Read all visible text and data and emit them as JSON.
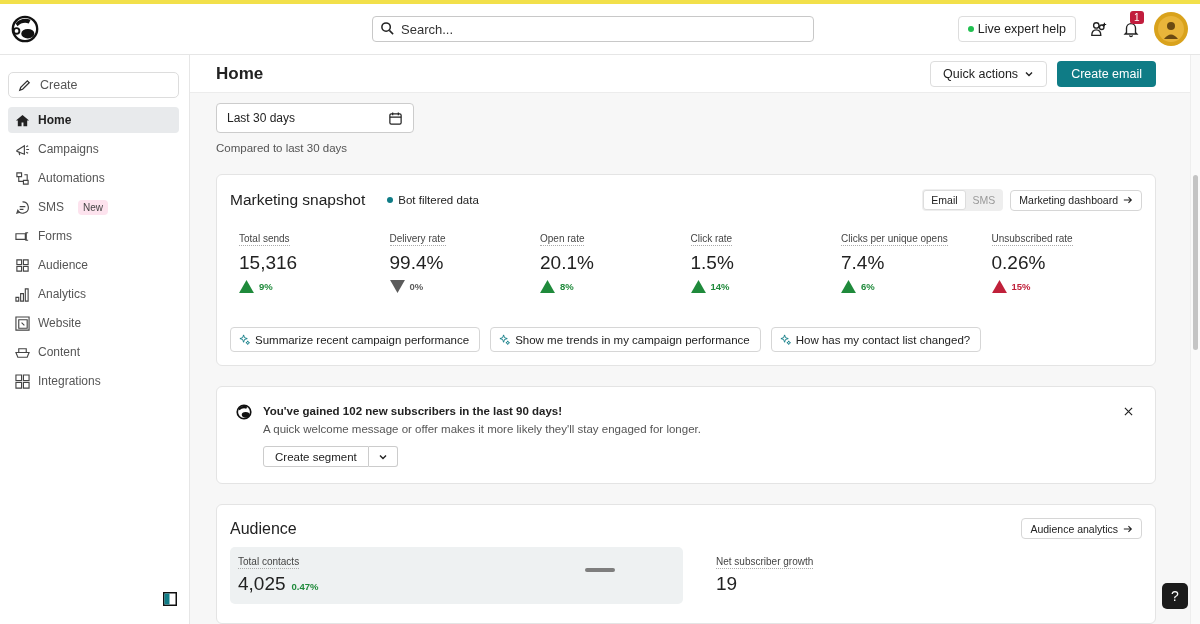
{
  "header": {
    "search": {
      "placeholder": "Search..."
    },
    "help_button": "Live expert help",
    "notifications": {
      "count": "1"
    }
  },
  "sidebar": {
    "create": "Create",
    "items": [
      {
        "label": "Home",
        "selected": true
      },
      {
        "label": "Campaigns",
        "selected": false
      },
      {
        "label": "Automations",
        "selected": false
      },
      {
        "label": "SMS",
        "selected": false,
        "badge": "New"
      },
      {
        "label": "Forms",
        "selected": false
      },
      {
        "label": "Audience",
        "selected": false
      },
      {
        "label": "Analytics",
        "selected": false
      },
      {
        "label": "Website",
        "selected": false
      },
      {
        "label": "Content",
        "selected": false
      },
      {
        "label": "Integrations",
        "selected": false
      }
    ]
  },
  "page": {
    "title": "Home",
    "quick_actions": "Quick actions",
    "create_email": "Create email"
  },
  "date_filter": {
    "value": "Last 30 days",
    "caption": "Compared to last 30 days"
  },
  "snapshot": {
    "title": "Marketing snapshot",
    "bot_filter": "Bot filtered data",
    "channels": [
      {
        "label": "Email",
        "selected": true
      },
      {
        "label": "SMS",
        "selected": false
      }
    ],
    "dashboard_link": "Marketing dashboard",
    "metrics": [
      {
        "label": "Total sends",
        "value": "15,316",
        "change": "9%",
        "kind": "up",
        "color": "#1f8a3b"
      },
      {
        "label": "Delivery rate",
        "value": "99.4%",
        "change": "0%",
        "kind": "down",
        "color": "#5b5b5b"
      },
      {
        "label": "Open rate",
        "value": "20.1%",
        "change": "8%",
        "kind": "up",
        "color": "#1f8a3b"
      },
      {
        "label": "Click rate",
        "value": "1.5%",
        "change": "14%",
        "kind": "up",
        "color": "#1f8a3b"
      },
      {
        "label": "Clicks per unique opens",
        "value": "7.4%",
        "change": "6%",
        "kind": "up",
        "color": "#1f8a3b"
      },
      {
        "label": "Unsubscribed rate",
        "value": "0.26%",
        "change": "15%",
        "kind": "up",
        "color": "#c0203a"
      }
    ],
    "prompts": [
      "Summarize recent campaign performance",
      "Show me trends in my campaign performance",
      "How has my contact list changed?"
    ]
  },
  "notice": {
    "title": "You've gained 102 new subscribers in the last 90 days!",
    "text": "A quick welcome message or offer makes it more likely they'll stay engaged for longer.",
    "button": "Create segment"
  },
  "audience": {
    "title": "Audience",
    "link": "Audience analytics",
    "stats": [
      {
        "label": "Total contacts",
        "value": "4,025",
        "change": "0.47%"
      },
      {
        "label": "Net subscriber growth",
        "value": "19"
      }
    ]
  },
  "help": "?"
}
